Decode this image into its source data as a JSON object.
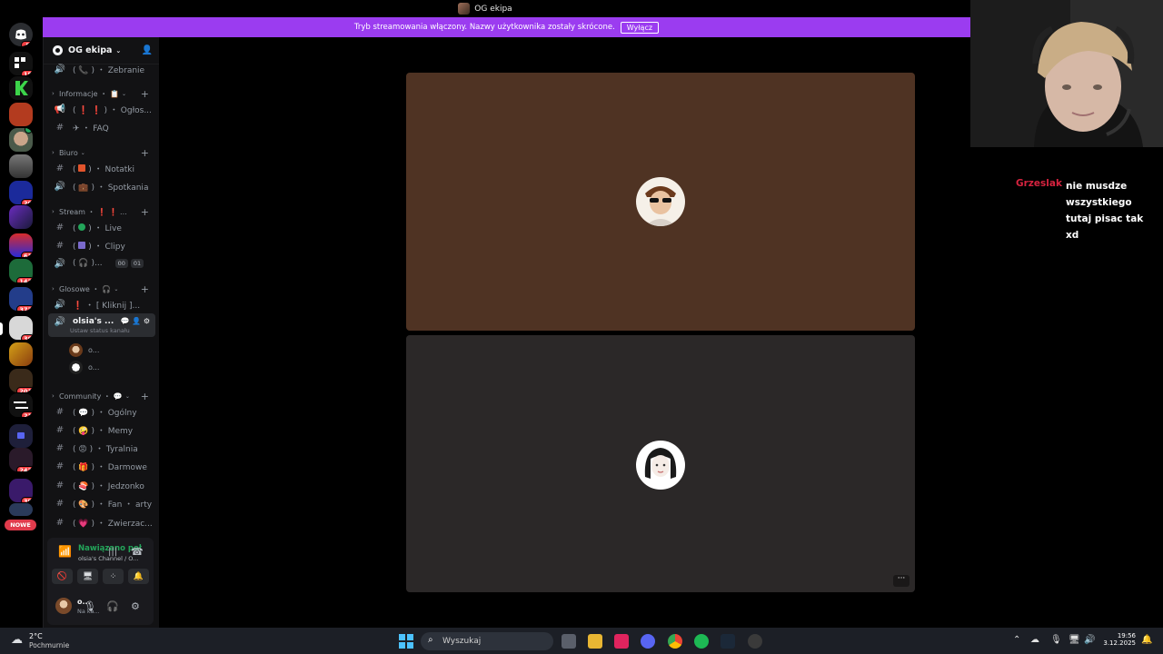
{
  "window": {
    "title": "OG ekipa"
  },
  "banner": {
    "text": "Tryb streamowania włączony. Nazwy użytkownika zostały skrócone.",
    "button": "Wyłącz"
  },
  "rail": {
    "badges": [
      "8",
      "18",
      "20",
      "61",
      "142",
      "373",
      "36",
      "201",
      "21",
      "243",
      "39"
    ],
    "new_label": "NOWE"
  },
  "server": {
    "name": "OG ekipa"
  },
  "channels": {
    "zebranie": "Zebranie",
    "cat_informacje": "Informacje ・",
    "ogloszenia": "Ogłos...",
    "faq": "FAQ",
    "cat_biuro": "Biuro",
    "notatki": "Notatki",
    "spotkania": "Spotkania",
    "cat_stream": "Stream ・ ❗ ❗ ...",
    "live": "Live",
    "clipy": "Clipy",
    "headset_ch": "...",
    "chip_a": "00",
    "chip_b": "01",
    "cat_glosowe": "Glosowe ・",
    "kliknij": "❗ ・ [ Kliknij ]...",
    "olsia": "olsia's ...",
    "olsia_status": "Ustaw status kanału",
    "member1": "o...",
    "member2": "o...",
    "cat_community": "Community ・",
    "ogolny": "Ogólny",
    "memy": "Memy",
    "tyralnia": "Tyralnia",
    "darmowe": "Darmowe",
    "jedzonko": "Jedzonko",
    "fan_arty": "Fan ・ arty",
    "zwierzaki": "Zwierzac..."
  },
  "voice_panel": {
    "status": "Nawiązano poł",
    "channel": "olsia's Channel / O...",
    "user_name": "o...",
    "user_status": "Na ka..."
  },
  "chat": {
    "author": "Grzeslak",
    "message": "nie musdze wszystkiego tutaj pisac tak xd"
  },
  "taskbar": {
    "temp": "2°C",
    "weather": "Pochmurnie",
    "search_placeholder": "Wyszukaj",
    "time": "19:56",
    "date": "3.12.2025"
  },
  "colors": {
    "banner": "#9b3cf0",
    "connected": "#23a55a",
    "chat_author": "#d6233f",
    "tile_top": "#4f3323",
    "tile_bottom": "#2b2828"
  }
}
